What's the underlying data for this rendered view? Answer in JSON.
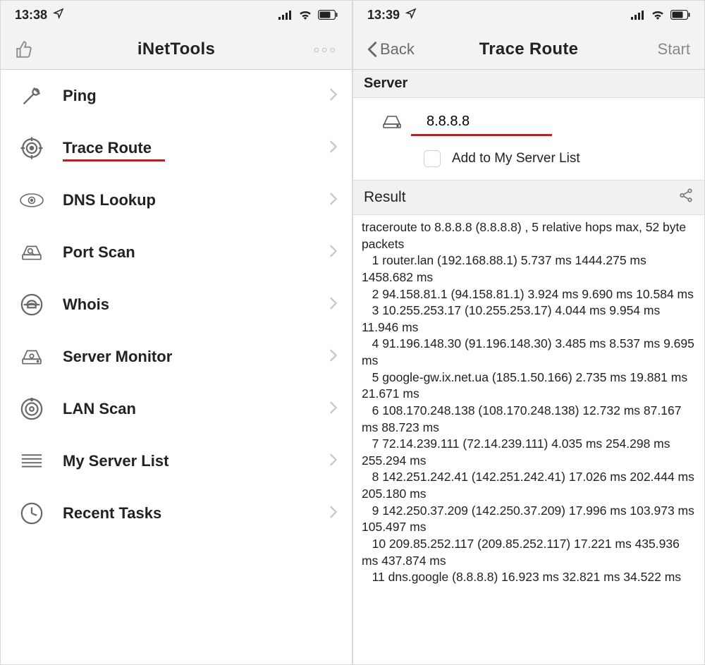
{
  "leftPhone": {
    "status": {
      "time": "13:38"
    },
    "nav": {
      "title": "iNetTools"
    },
    "tools": [
      {
        "label": "Ping",
        "name": "ping",
        "selected": false
      },
      {
        "label": "Trace Route",
        "name": "trace-route",
        "selected": true
      },
      {
        "label": "DNS Lookup",
        "name": "dns-lookup",
        "selected": false
      },
      {
        "label": "Port Scan",
        "name": "port-scan",
        "selected": false
      },
      {
        "label": "Whois",
        "name": "whois",
        "selected": false
      },
      {
        "label": "Server Monitor",
        "name": "server-monitor",
        "selected": false
      },
      {
        "label": "LAN Scan",
        "name": "lan-scan",
        "selected": false
      },
      {
        "label": "My Server List",
        "name": "my-server-list",
        "selected": false
      },
      {
        "label": "Recent Tasks",
        "name": "recent-tasks",
        "selected": false
      }
    ]
  },
  "rightPhone": {
    "status": {
      "time": "13:39"
    },
    "nav": {
      "back": "Back",
      "title": "Trace Route",
      "start": "Start"
    },
    "server": {
      "heading": "Server",
      "value": "8.8.8.8",
      "addToListLabel": "Add to My Server List"
    },
    "result": {
      "heading": "Result",
      "text": "traceroute to 8.8.8.8 (8.8.8.8) , 5 relative hops max, 52 byte packets\n   1 router.lan (192.168.88.1) 5.737 ms 1444.275 ms 1458.682 ms\n   2 94.158.81.1 (94.158.81.1) 3.924 ms 9.690 ms 10.584 ms\n   3 10.255.253.17 (10.255.253.17) 4.044 ms 9.954 ms 11.946 ms\n   4 91.196.148.30 (91.196.148.30) 3.485 ms 8.537 ms 9.695 ms\n   5 google-gw.ix.net.ua (185.1.50.166) 2.735 ms 19.881 ms 21.671 ms\n   6 108.170.248.138 (108.170.248.138) 12.732 ms 87.167 ms 88.723 ms\n   7 72.14.239.111 (72.14.239.111) 4.035 ms 254.298 ms 255.294 ms\n   8 142.251.242.41 (142.251.242.41) 17.026 ms 202.444 ms 205.180 ms\n   9 142.250.37.209 (142.250.37.209) 17.996 ms 103.973 ms 105.497 ms\n   10 209.85.252.117 (209.85.252.117) 17.221 ms 435.936 ms 437.874 ms\n   11 dns.google (8.8.8.8) 16.923 ms 32.821 ms 34.522 ms"
    }
  }
}
